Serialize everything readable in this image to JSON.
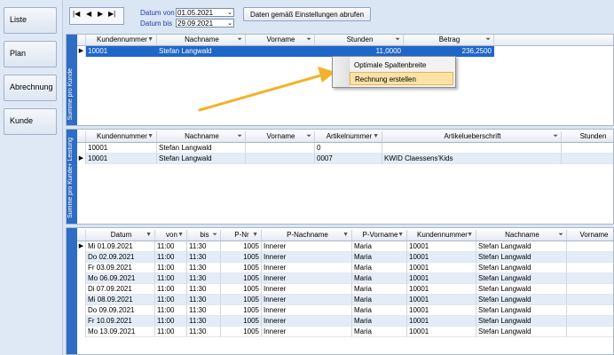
{
  "nav": {
    "items": [
      "Liste",
      "Plan",
      "Abrechnung",
      "Kunde"
    ]
  },
  "toolbar": {
    "nav_buttons": [
      "|◀",
      "◀",
      "▶",
      "▶|"
    ],
    "date_from_label": "Datum von",
    "date_from": "01.05.2021",
    "date_to_label": "Datum bis",
    "date_to": "29.09.2021",
    "fetch_button": "Daten gemäß Einstellungen abrufen"
  },
  "panel1": {
    "side_label": "Summe pro Kunde",
    "headers": [
      "Kundennummer",
      "Nachname",
      "Vorname",
      "Stunden",
      "Betrag"
    ],
    "rows": [
      [
        "10001",
        "Stefan Langwald",
        "",
        "11,0000",
        "236,2500"
      ]
    ]
  },
  "panel2": {
    "side_label": "Summe pro Kunde+ Leistung",
    "headers": [
      "Kundennummer",
      "Nachname",
      "Vorname",
      "Artikelnummer",
      "Artikelueberschrift",
      "Stunden"
    ],
    "rows": [
      [
        "10001",
        "Stefan Langwald",
        "",
        "0",
        "",
        ""
      ],
      [
        "10001",
        "Stefan Langwald",
        "",
        "0007",
        "KWID Claessens'Kids",
        ""
      ]
    ]
  },
  "panel3": {
    "headers": [
      "Datum",
      "von",
      "bis",
      "P-Nr",
      "P-Nachname",
      "P-Vorname",
      "Kundennummer",
      "Nachname",
      "Vorname"
    ],
    "rows": [
      [
        "Mi 01.09.2021",
        "11:00",
        "11:30",
        "1005",
        "Innerer",
        "Maria",
        "10001",
        "Stefan Langwald",
        ""
      ],
      [
        "Do 02.09.2021",
        "11:00",
        "11:30",
        "1005",
        "Innerer",
        "Maria",
        "10001",
        "Stefan Langwald",
        ""
      ],
      [
        "Fr 03.09.2021",
        "11:00",
        "11:30",
        "1005",
        "Innerer",
        "Maria",
        "10001",
        "Stefan Langwald",
        ""
      ],
      [
        "Mo 06.09.2021",
        "11:00",
        "11:30",
        "1005",
        "Innerer",
        "Maria",
        "10001",
        "Stefan Langwald",
        ""
      ],
      [
        "Di 07.09.2021",
        "11:00",
        "11:30",
        "1005",
        "Innerer",
        "Maria",
        "10001",
        "Stefan Langwald",
        ""
      ],
      [
        "Mi 08.09.2021",
        "11:00",
        "11:30",
        "1005",
        "Innerer",
        "Maria",
        "10001",
        "Stefan Langwald",
        ""
      ],
      [
        "Do 09.09.2021",
        "11:00",
        "11:30",
        "1005",
        "Innerer",
        "Maria",
        "10001",
        "Stefan Langwald",
        ""
      ],
      [
        "Fr 10.09.2021",
        "11:00",
        "11:30",
        "1005",
        "Innerer",
        "Maria",
        "10001",
        "Stefan Langwald",
        ""
      ],
      [
        "Mo 13.09.2021",
        "11:00",
        "11:30",
        "1005",
        "Innerer",
        "Maria",
        "10001",
        "Stefan Langwald",
        ""
      ]
    ]
  },
  "context_menu": {
    "items": [
      "Optimale Spaltenbreite",
      "Rechnung erstellen"
    ],
    "highlighted": 1
  },
  "colors": {
    "selection": "#1f66c9",
    "sidebar": "#2f6cc4",
    "arrow": "#f2b32a",
    "menu_highlight": "#fbe3a6"
  }
}
